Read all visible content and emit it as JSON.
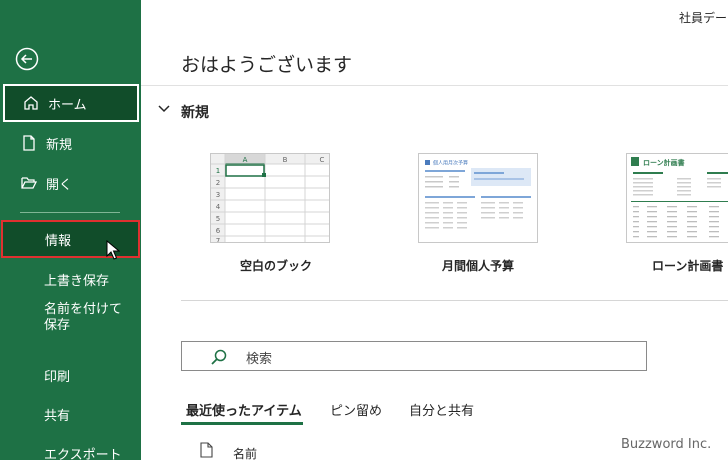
{
  "window": {
    "doc_title": "社員データ"
  },
  "sidebar": {
    "home": "ホーム",
    "new": "新規",
    "open": "開く",
    "info": "情報",
    "overwrite_save": "上書き保存",
    "save_as": "名前を付けて保存",
    "print": "印刷",
    "share": "共有",
    "export": "エクスポート"
  },
  "main": {
    "greeting": "おはようございます",
    "new_heading": "新規",
    "templates": [
      {
        "label": "空白のブック"
      },
      {
        "label": "月間個人予算"
      },
      {
        "label": "ローン計画書"
      }
    ],
    "blank_grid": {
      "cols": [
        "A",
        "B",
        "C"
      ],
      "rows": [
        "1",
        "2",
        "3",
        "4",
        "5",
        "6",
        "7"
      ]
    },
    "budget_thumb_title": "個人用月次予算",
    "loan_thumb_title": "ローン計画書",
    "search_placeholder": "検索",
    "tabs": [
      "最近使ったアイテム",
      "ピン留め",
      "自分と共有"
    ],
    "column_name": "名前"
  },
  "watermark": "Buzzword Inc.",
  "colors": {
    "sidebar": "#1e7145",
    "selected": "#114d2a",
    "info_border": "#e03030",
    "accent": "#1e7145"
  }
}
